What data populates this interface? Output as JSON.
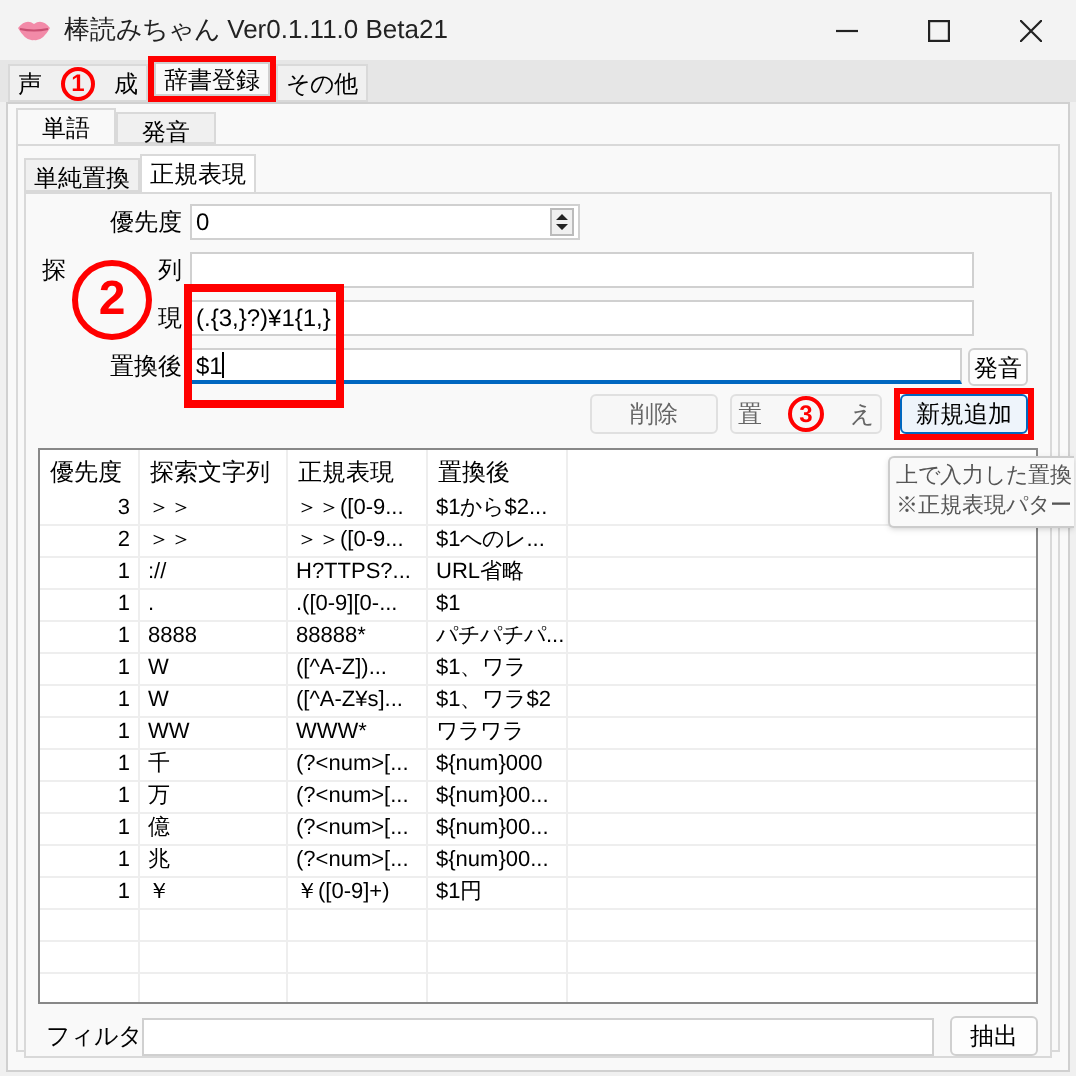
{
  "window": {
    "title": "棒読みちゃん Ver0.1.11.0 Beta21"
  },
  "tabs": [
    {
      "label_parts": [
        "声",
        "成"
      ],
      "selected": false
    },
    {
      "label_parts": [
        "辞書登録"
      ],
      "selected": true
    },
    {
      "label_parts": [
        "その他"
      ],
      "selected": false
    }
  ],
  "sub_tabs": [
    {
      "label": "単語",
      "selected": true
    },
    {
      "label": "発音",
      "selected": false
    }
  ],
  "mode_tabs": [
    {
      "label": "単純置換",
      "selected": false
    },
    {
      "label": "正規表現",
      "selected": true
    }
  ],
  "form": {
    "fields": [
      {
        "label_parts": [
          "優先度"
        ],
        "value": "0",
        "kind": "spinner",
        "focused": false
      },
      {
        "label_parts": [
          "探",
          "列"
        ],
        "kind": "text",
        "focused": false
      },
      {
        "label_parts": [
          "現"
        ],
        "value": "(.{3,}?)¥1{1,}",
        "kind": "text",
        "focused": false
      },
      {
        "label_parts": [
          "置換後"
        ],
        "value": "$1",
        "kind": "text",
        "focused": true,
        "button": "発音"
      }
    ],
    "buttons": [
      {
        "label_parts": [
          "削除"
        ],
        "primary": false
      },
      {
        "label_parts": [
          "置",
          "え"
        ],
        "primary": false
      },
      {
        "label_parts": [
          "新規追加"
        ],
        "primary": true
      }
    ]
  },
  "table": {
    "columns": [
      "優先度",
      "探索文字列",
      "正規表現",
      "置換後"
    ],
    "rows": [
      [
        "3",
        "＞＞",
        "＞＞([0-9...",
        "$1から$2..."
      ],
      [
        "2",
        "＞＞",
        "＞＞([0-9...",
        "$1へのレ..."
      ],
      [
        "1",
        "://",
        "H?TTPS?...",
        "URL省略"
      ],
      [
        "1",
        ".",
        ".([0-9][0-...",
        "$1"
      ],
      [
        "1",
        "8888",
        "88888*",
        "パチパチパ..."
      ],
      [
        "1",
        "W",
        "([^A-Z])...",
        "$1、ワラ"
      ],
      [
        "1",
        "W",
        "([^A-Z¥s]...",
        "$1、ワラ$2"
      ],
      [
        "1",
        "WW",
        "WWW*",
        "ワラワラ"
      ],
      [
        "1",
        "千",
        "(?<num>[...",
        "${num}000"
      ],
      [
        "1",
        "万",
        "(?<num>[...",
        "${num}00..."
      ],
      [
        "1",
        "億",
        "(?<num>[...",
        "${num}00..."
      ],
      [
        "1",
        "兆",
        "(?<num>[...",
        "${num}00..."
      ],
      [
        "1",
        "￥",
        "￥([0-9]+)",
        "$1円"
      ]
    ]
  },
  "tooltip": {
    "lines": [
      "上で入力した置換",
      "※正規表現パター"
    ]
  },
  "filter": {
    "label": "フィルタ",
    "button": "抽出"
  },
  "annotations": [
    {
      "kind": "circle",
      "label": "1"
    },
    {
      "kind": "box"
    },
    {
      "kind": "circle",
      "label": "2"
    },
    {
      "kind": "box"
    },
    {
      "kind": "circle",
      "label": "3"
    },
    {
      "kind": "box"
    }
  ]
}
